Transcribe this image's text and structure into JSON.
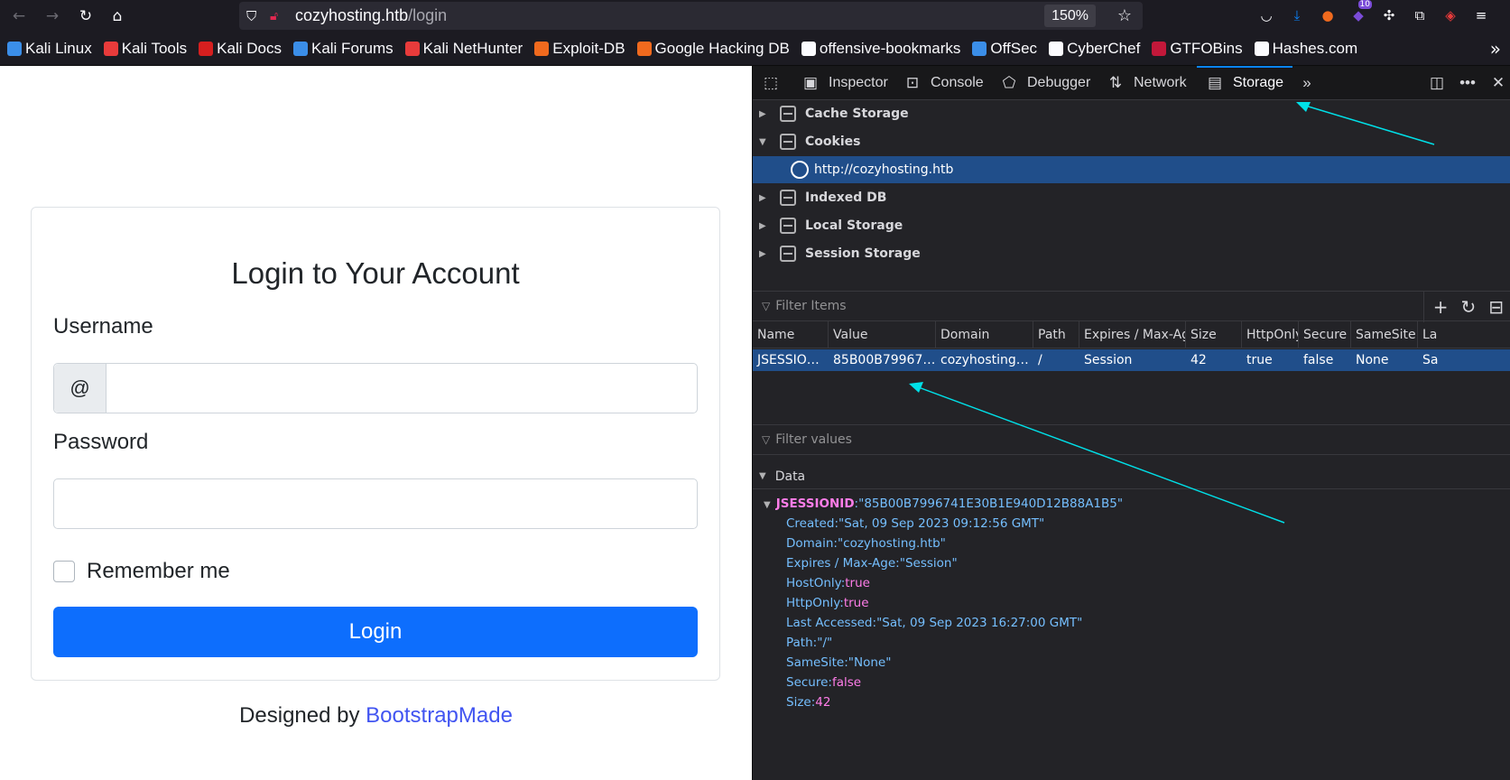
{
  "browser": {
    "url_host": "cozyhosting.htb",
    "url_path": "/login",
    "zoom": "150%",
    "extension_badge": "10"
  },
  "bookmarks": [
    {
      "label": "Kali Linux",
      "color": "#3b8ee8"
    },
    {
      "label": "Kali Tools",
      "color": "#e83b3b"
    },
    {
      "label": "Kali Docs",
      "color": "#d61f1f"
    },
    {
      "label": "Kali Forums",
      "color": "#3b8ee8"
    },
    {
      "label": "Kali NetHunter",
      "color": "#e83b3b"
    },
    {
      "label": "Exploit-DB",
      "color": "#f06a1e"
    },
    {
      "label": "Google Hacking DB",
      "color": "#f06a1e"
    },
    {
      "label": "offensive-bookmarks",
      "color": "#fbfbfe"
    },
    {
      "label": "OffSec",
      "color": "#3b8ee8"
    },
    {
      "label": "CyberChef",
      "color": "#fbfbfe"
    },
    {
      "label": "GTFOBins",
      "color": "#c2183a"
    },
    {
      "label": "Hashes.com",
      "color": "#fbfbfe"
    }
  ],
  "login": {
    "title": "Login to Your Account",
    "username_label": "Username",
    "username_prefix": "@",
    "password_label": "Password",
    "remember_label": "Remember me",
    "login_button": "Login",
    "footer_text": "Designed by ",
    "footer_link": "BootstrapMade"
  },
  "devtools": {
    "tabs": [
      "Inspector",
      "Console",
      "Debugger",
      "Network",
      "Storage"
    ],
    "active_tab": "Storage",
    "tree": {
      "cache_storage": "Cache Storage",
      "cookies": "Cookies",
      "cookie_host": "http://cozyhosting.htb",
      "indexed_db": "Indexed DB",
      "local_storage": "Local Storage",
      "session_storage": "Session Storage"
    },
    "filter_items_placeholder": "Filter Items",
    "filter_values_placeholder": "Filter values",
    "columns": [
      "Name",
      "Value",
      "Domain",
      "Path",
      "Expires / Max-Age",
      "Size",
      "HttpOnly",
      "Secure",
      "SameSite",
      "La"
    ],
    "row": [
      "JSESSIO…",
      "85B00B79967…",
      "cozyhosting…",
      "/",
      "Session",
      "42",
      "true",
      "false",
      "None",
      "Sa"
    ],
    "data_header": "Data",
    "root_key": "JSESSIONID",
    "root_value": "\"85B00B7996741E30B1E940D12B88A1B5\"",
    "props": [
      {
        "k": "Created",
        "v": "\"Sat, 09 Sep 2023 09:12:56 GMT\"",
        "bool": false
      },
      {
        "k": "Domain",
        "v": "\"cozyhosting.htb\"",
        "bool": false
      },
      {
        "k": "Expires / Max-Age",
        "v": "\"Session\"",
        "bool": false
      },
      {
        "k": "HostOnly",
        "v": "true",
        "bool": true
      },
      {
        "k": "HttpOnly",
        "v": "true",
        "bool": true
      },
      {
        "k": "Last Accessed",
        "v": "\"Sat, 09 Sep 2023 16:27:00 GMT\"",
        "bool": false
      },
      {
        "k": "Path",
        "v": "\"/\"",
        "bool": false
      },
      {
        "k": "SameSite",
        "v": "\"None\"",
        "bool": false
      },
      {
        "k": "Secure",
        "v": "false",
        "bool": true
      },
      {
        "k": "Size",
        "v": "42",
        "bool": true
      }
    ]
  },
  "annotation_color": "#00e0e8"
}
